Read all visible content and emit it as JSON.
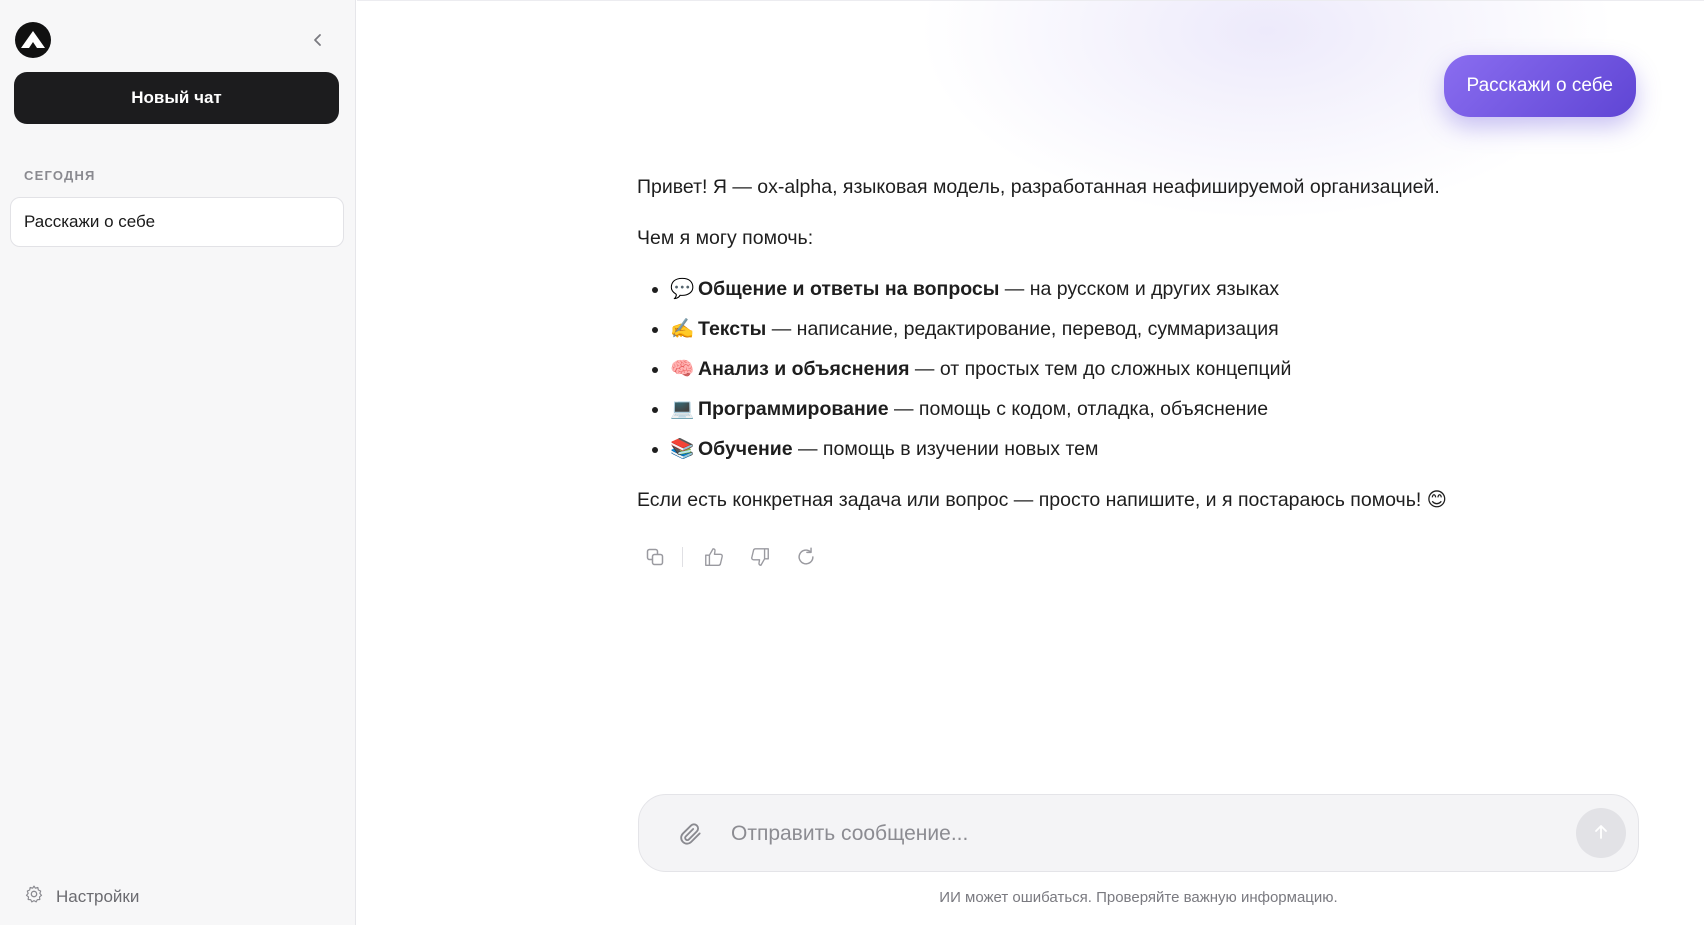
{
  "sidebar": {
    "new_chat_label": "Новый чат",
    "section_label": "СЕГОДНЯ",
    "history": [
      {
        "title": "Расскажи о себе"
      }
    ],
    "settings_label": "Настройки"
  },
  "chat": {
    "user_message": "Расскажи о себе",
    "intro": "Привет! Я — ox-alpha, языковая модель, разработанная неафишируемой организацией.",
    "help_heading": "Чем я могу помочь:",
    "capabilities": [
      {
        "icon": "💬",
        "title": "Общение и ответы на вопросы",
        "text": " — на русском и других языках"
      },
      {
        "icon": "✍️",
        "title": "Тексты",
        "text": " — написание, редактирование, перевод, суммаризация"
      },
      {
        "icon": "🧠",
        "title": "Анализ и объяснения",
        "text": " — от простых тем до сложных концепций"
      },
      {
        "icon": "💻",
        "title": "Программирование",
        "text": " — помощь с кодом, отладка, объяснение"
      },
      {
        "icon": "📚",
        "title": "Обучение",
        "text": " — помощь в изучении новых тем"
      }
    ],
    "closing": "Если есть конкретная задача или вопрос — просто напишите, и я постараюсь помочь! 😊"
  },
  "composer": {
    "placeholder": "Отправить сообщение...",
    "value": ""
  },
  "disclaimer": "ИИ может ошибаться. Проверяйте важную информацию.",
  "colors": {
    "accent_start": "#8a6df0",
    "accent_end": "#5f45d4",
    "sidebar_bg": "#f7f7f8",
    "primary_button": "#1c1c1e"
  }
}
